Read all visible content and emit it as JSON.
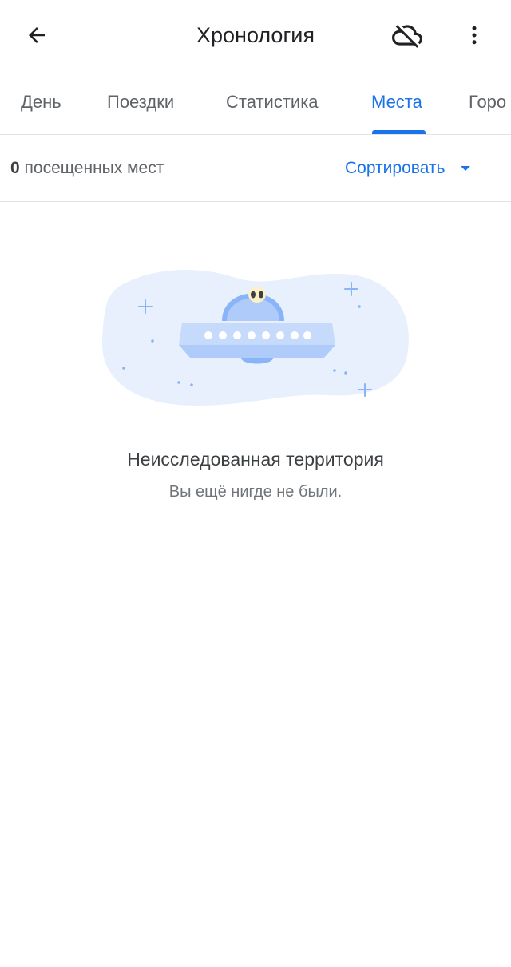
{
  "app_bar": {
    "title": "Хронология",
    "back_icon": "arrow-back-icon",
    "cloud_icon": "cloud-off-icon",
    "more_icon": "more-vert-icon"
  },
  "tabs": [
    {
      "label": "День",
      "active": false
    },
    {
      "label": "Поездки",
      "active": false
    },
    {
      "label": "Статистика",
      "active": false
    },
    {
      "label": "Места",
      "active": true
    },
    {
      "label": "Горо",
      "active": false
    }
  ],
  "summary": {
    "count": "0",
    "count_label": "посещенных мест",
    "sort_label": "Сортировать"
  },
  "empty_state": {
    "illustration": "ufo-illustration",
    "title": "Неисследованная территория",
    "subtitle": "Вы ещё нигде не были."
  },
  "colors": {
    "accent": "#1a73e8",
    "text_primary": "#202124",
    "text_secondary": "#5f6368",
    "divider": "#e3e3e3",
    "illustration_bg": "#e8f0fe"
  }
}
